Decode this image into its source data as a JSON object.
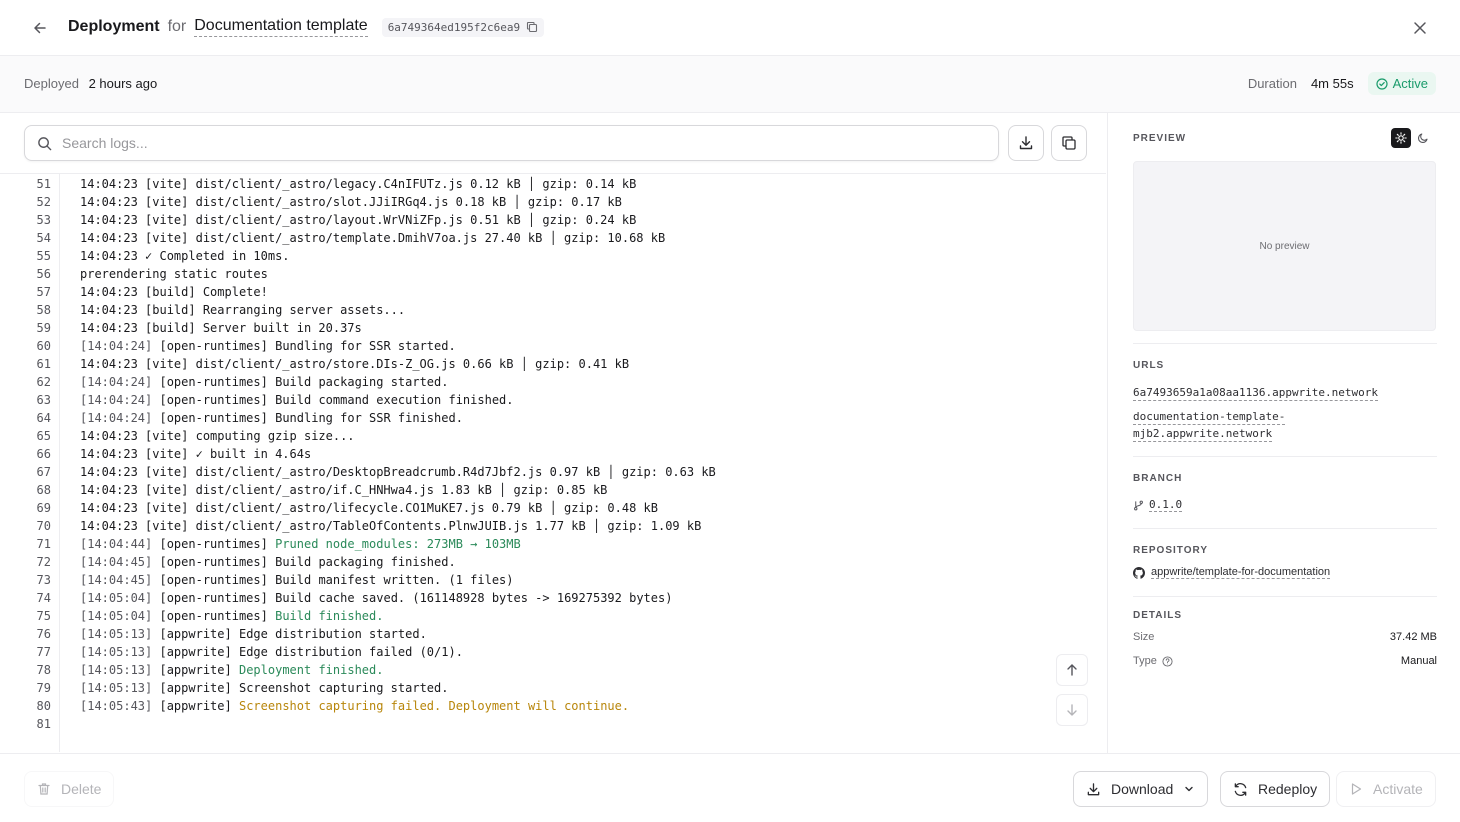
{
  "header": {
    "title": "Deployment",
    "for_text": "for",
    "project": "Documentation template",
    "deployment_id": "6a749364ed195f2c6ea9"
  },
  "meta": {
    "deployed_label": "Deployed",
    "deployed_value": "2 hours ago",
    "duration_label": "Duration",
    "duration_value": "4m 55s",
    "status": "Active"
  },
  "search": {
    "placeholder": "Search logs..."
  },
  "logs": [
    {
      "n": "51",
      "ts": "",
      "tag": "",
      "msg": "14:04:23 [vite] dist/client/_astro/legacy.C4nIFUTz.js 0.12 kB │ gzip: 0.14 kB",
      "tone": ""
    },
    {
      "n": "52",
      "ts": "",
      "tag": "",
      "msg": "14:04:23 [vite] dist/client/_astro/slot.JJiIRGq4.js 0.18 kB │ gzip: 0.17 kB",
      "tone": ""
    },
    {
      "n": "53",
      "ts": "",
      "tag": "",
      "msg": "14:04:23 [vite] dist/client/_astro/layout.WrVNiZFp.js 0.51 kB │ gzip: 0.24 kB",
      "tone": ""
    },
    {
      "n": "54",
      "ts": "",
      "tag": "",
      "msg": "14:04:23 [vite] dist/client/_astro/template.DmihV7oa.js 27.40 kB │ gzip: 10.68 kB",
      "tone": ""
    },
    {
      "n": "55",
      "ts": "",
      "tag": "",
      "msg": "14:04:23 ✓ Completed in 10ms.",
      "tone": ""
    },
    {
      "n": "56",
      "ts": "",
      "tag": "",
      "msg": "prerendering static routes",
      "tone": ""
    },
    {
      "n": "57",
      "ts": "",
      "tag": "",
      "msg": "14:04:23 [build] Complete!",
      "tone": ""
    },
    {
      "n": "58",
      "ts": "",
      "tag": "",
      "msg": "14:04:23 [build] Rearranging server assets...",
      "tone": ""
    },
    {
      "n": "59",
      "ts": "",
      "tag": "",
      "msg": "14:04:23 [build] Server built in 20.37s",
      "tone": ""
    },
    {
      "n": "60",
      "ts": "[14:04:24]",
      "tag": "[open-runtimes]",
      "msg": "Bundling for SSR started.",
      "tone": ""
    },
    {
      "n": "61",
      "ts": "",
      "tag": "",
      "msg": "14:04:23 [vite] dist/client/_astro/store.DIs-Z_OG.js 0.66 kB │ gzip: 0.41 kB",
      "tone": ""
    },
    {
      "n": "62",
      "ts": "[14:04:24]",
      "tag": "[open-runtimes]",
      "msg": "Build packaging started.",
      "tone": ""
    },
    {
      "n": "63",
      "ts": "[14:04:24]",
      "tag": "[open-runtimes]",
      "msg": "Build command execution finished.",
      "tone": ""
    },
    {
      "n": "64",
      "ts": "[14:04:24]",
      "tag": "[open-runtimes]",
      "msg": "Bundling for SSR finished.",
      "tone": ""
    },
    {
      "n": "65",
      "ts": "",
      "tag": "",
      "msg": "14:04:23 [vite] computing gzip size...",
      "tone": ""
    },
    {
      "n": "66",
      "ts": "",
      "tag": "",
      "msg": "14:04:23 [vite] ✓ built in 4.64s",
      "tone": ""
    },
    {
      "n": "67",
      "ts": "",
      "tag": "",
      "msg": "14:04:23 [vite] dist/client/_astro/DesktopBreadcrumb.R4d7Jbf2.js 0.97 kB │ gzip: 0.63 kB",
      "tone": ""
    },
    {
      "n": "68",
      "ts": "",
      "tag": "",
      "msg": "14:04:23 [vite] dist/client/_astro/if.C_HNHwa4.js 1.83 kB │ gzip: 0.85 kB",
      "tone": ""
    },
    {
      "n": "69",
      "ts": "",
      "tag": "",
      "msg": "14:04:23 [vite] dist/client/_astro/lifecycle.CO1MuKE7.js 0.79 kB │ gzip: 0.48 kB",
      "tone": ""
    },
    {
      "n": "70",
      "ts": "",
      "tag": "",
      "msg": "14:04:23 [vite] dist/client/_astro/TableOfContents.PlnwJUIB.js 1.77 kB │ gzip: 1.09 kB",
      "tone": ""
    },
    {
      "n": "71",
      "ts": "[14:04:44]",
      "tag": "[open-runtimes]",
      "msg": "Pruned node_modules: 273MB → 103MB",
      "tone": "green"
    },
    {
      "n": "72",
      "ts": "[14:04:45]",
      "tag": "[open-runtimes]",
      "msg": "Build packaging finished.",
      "tone": ""
    },
    {
      "n": "73",
      "ts": "[14:04:45]",
      "tag": "[open-runtimes]",
      "msg": "Build manifest written. (1 files)",
      "tone": ""
    },
    {
      "n": "74",
      "ts": "[14:05:04]",
      "tag": "[open-runtimes]",
      "msg": "Build cache saved. (161148928 bytes -> 169275392 bytes)",
      "tone": ""
    },
    {
      "n": "75",
      "ts": "[14:05:04]",
      "tag": "[open-runtimes]",
      "msg": "Build finished.",
      "tone": "green"
    },
    {
      "n": "76",
      "ts": "[14:05:13]",
      "tag": "[appwrite]",
      "msg": "Edge distribution started.",
      "tone": ""
    },
    {
      "n": "77",
      "ts": "[14:05:13]",
      "tag": "[appwrite]",
      "msg": "Edge distribution failed (0/1).",
      "tone": ""
    },
    {
      "n": "78",
      "ts": "[14:05:13]",
      "tag": "[appwrite]",
      "msg": "Deployment finished.",
      "tone": "green"
    },
    {
      "n": "79",
      "ts": "[14:05:13]",
      "tag": "[appwrite]",
      "msg": "Screenshot capturing started.",
      "tone": ""
    },
    {
      "n": "80",
      "ts": "[14:05:43]",
      "tag": "[appwrite]",
      "msg": "Screenshot capturing failed. Deployment will continue.",
      "tone": "amber"
    },
    {
      "n": "81",
      "ts": "",
      "tag": "",
      "msg": "",
      "tone": ""
    }
  ],
  "panel": {
    "preview_label": "PREVIEW",
    "no_preview": "No preview",
    "urls_label": "URLS",
    "url_1": "6a7493659a1a08aa1136.appwrite.network",
    "url_2_line1": "documentation-template-",
    "url_2_line2": "mjb2.appwrite.network",
    "branch_label": "BRANCH",
    "branch": "0.1.0",
    "repository_label": "REPOSITORY",
    "repository": "appwrite/template-for-documentation",
    "details_label": "DETAILS",
    "size_label": "Size",
    "size_value": "37.42 MB",
    "type_label": "Type",
    "type_value": "Manual"
  },
  "footer": {
    "delete_label": "Delete",
    "download_label": "Download",
    "redeploy_label": "Redeploy",
    "activate_label": "Activate"
  },
  "icons": {
    "back": "arrow-left-icon",
    "close": "close-icon",
    "copy": "copy-icon",
    "search": "search-icon",
    "download": "download-icon",
    "check_circle": "check-circle-icon",
    "sun": "sun-icon",
    "moon": "moon-icon",
    "branch": "git-branch-icon",
    "github": "github-icon",
    "help": "help-circle-icon",
    "trash": "trash-icon",
    "refresh": "refresh-icon",
    "play": "play-icon",
    "chevron_down": "chevron-down-icon",
    "arrow_up": "arrow-up-icon",
    "arrow_down": "arrow-down-icon"
  },
  "colors": {
    "active_green": "#1a9b6b",
    "log_green": "#2b8a5a",
    "log_amber": "#b8860b",
    "border": "#ededf0"
  }
}
